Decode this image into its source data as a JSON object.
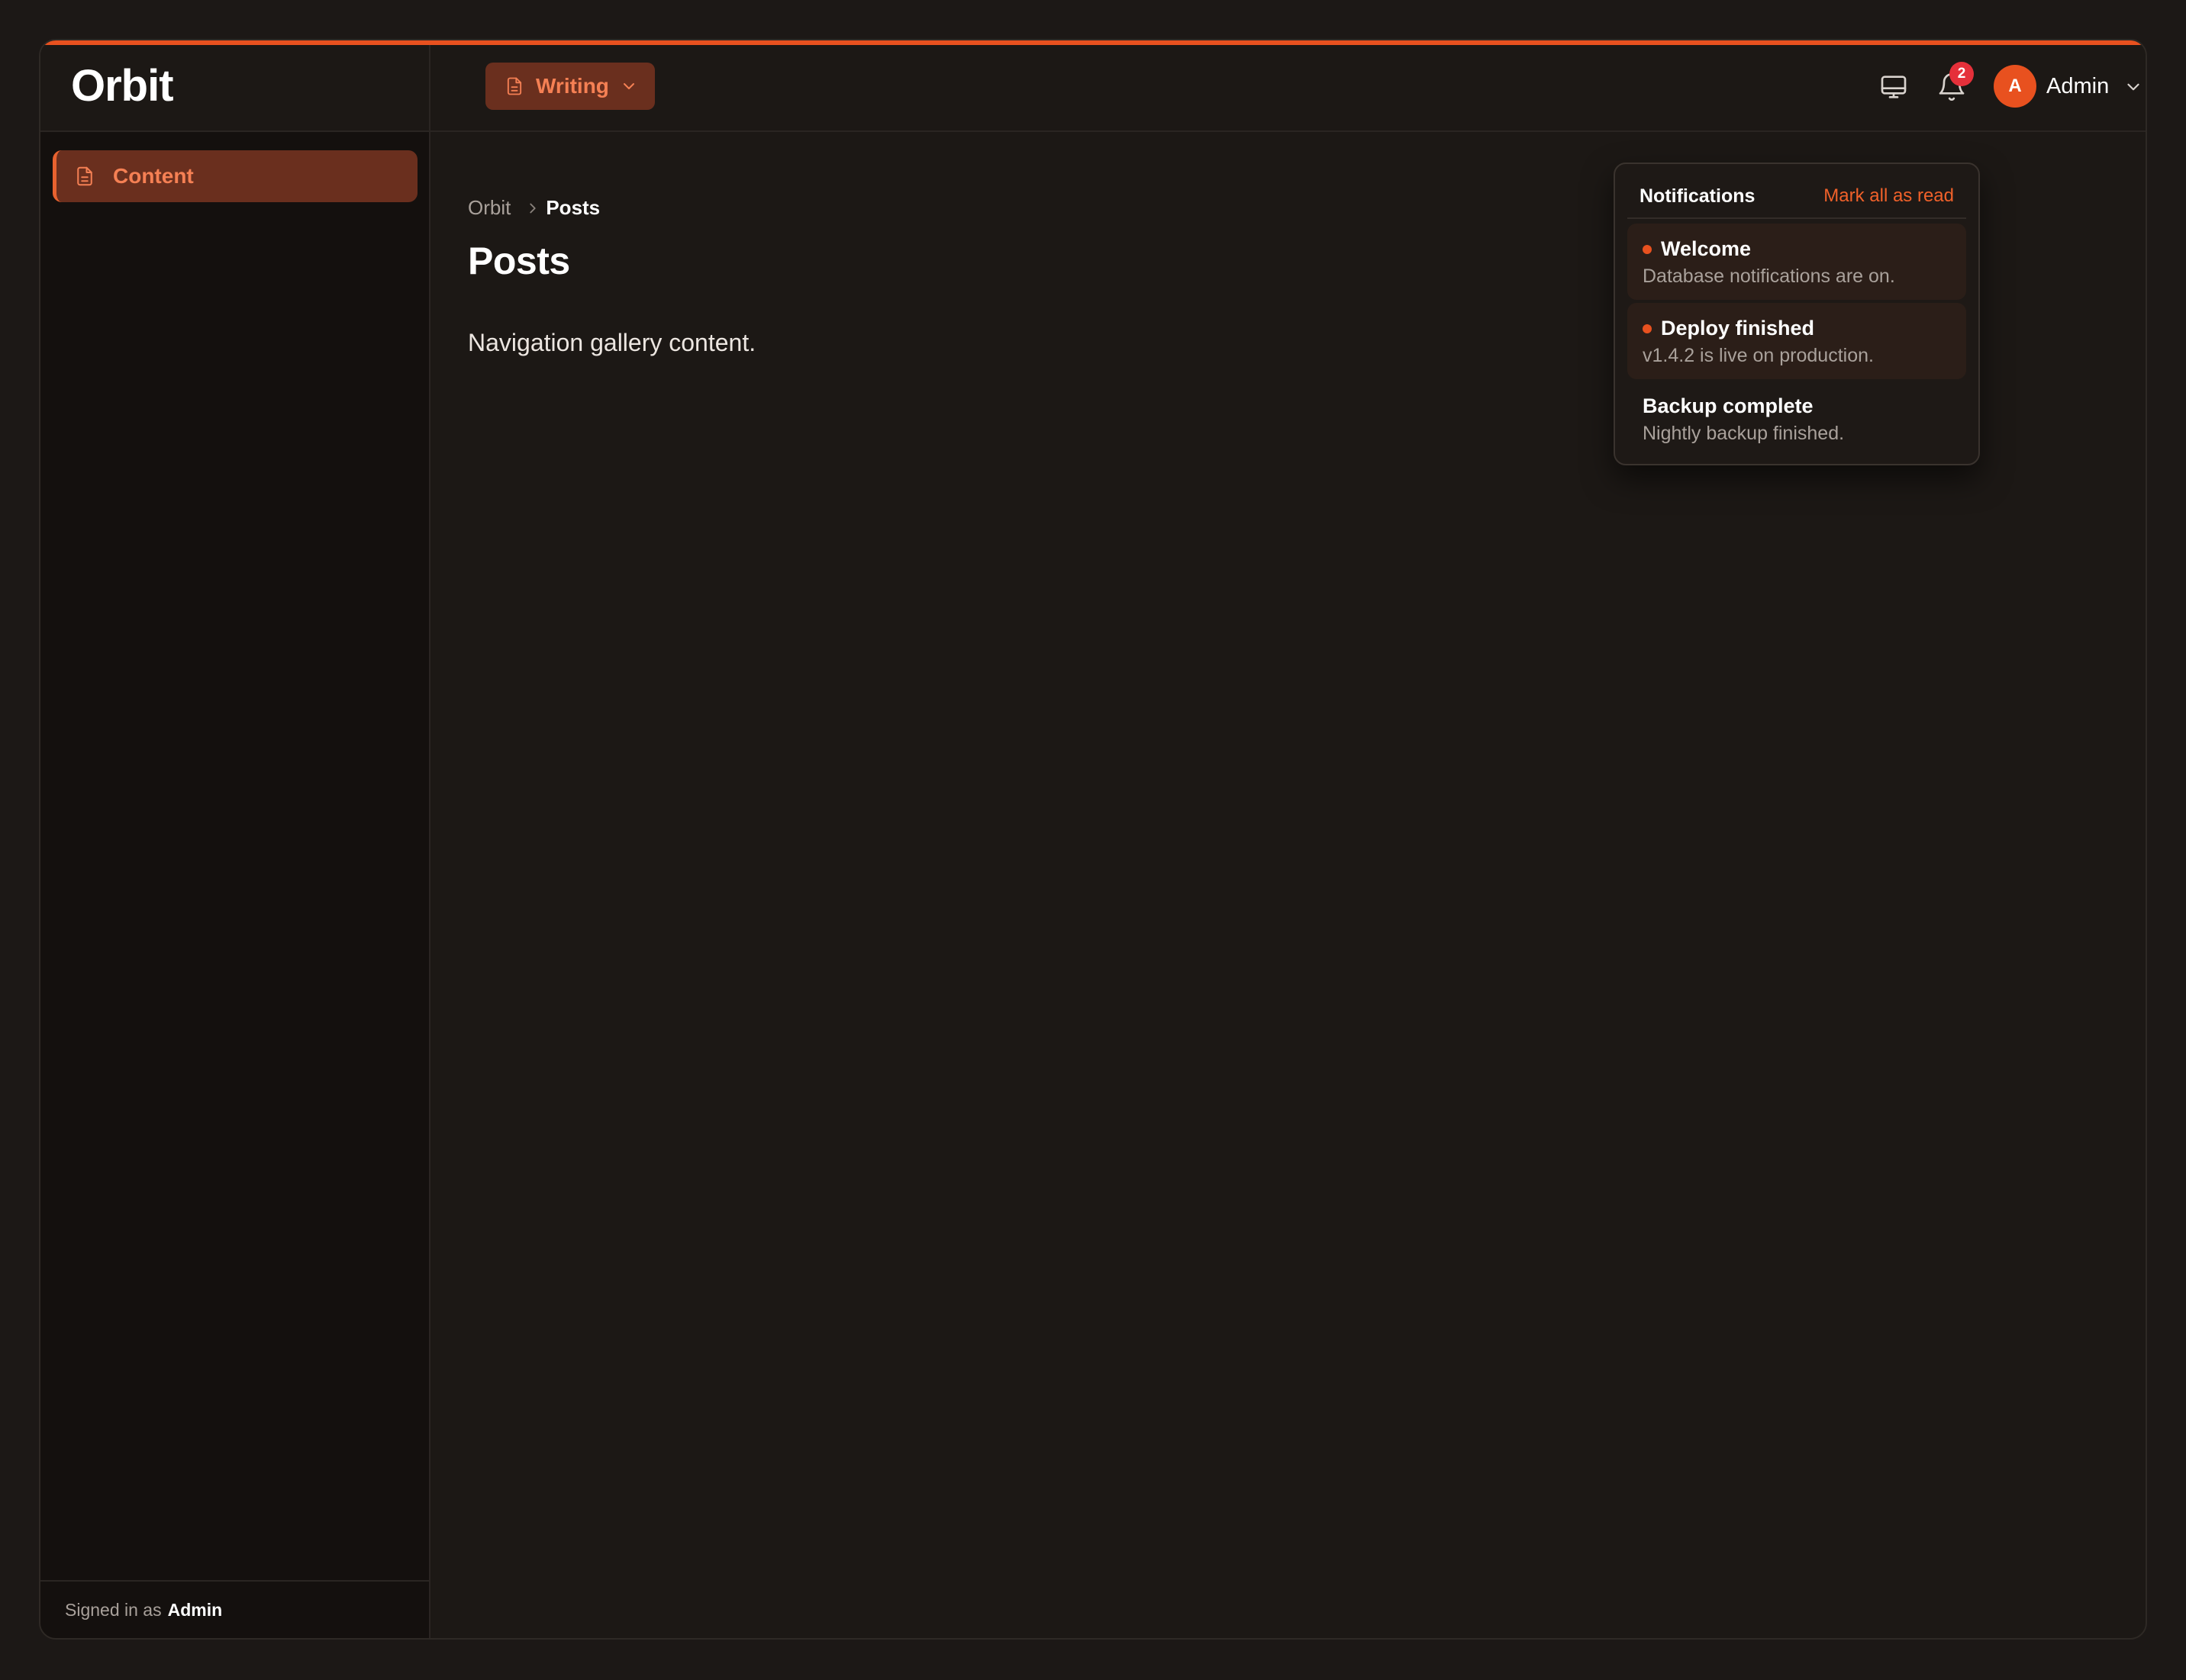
{
  "brand": "Orbit",
  "sidebar": {
    "items": [
      {
        "label": "Content",
        "icon": "document-icon"
      }
    ],
    "footer_prefix": "Signed in as",
    "footer_user": "Admin"
  },
  "topbar": {
    "context_label": "Writing",
    "notification_count": "2",
    "avatar_initial": "A",
    "user_name": "Admin"
  },
  "breadcrumb": {
    "root": "Orbit",
    "current": "Posts"
  },
  "page": {
    "title": "Posts",
    "body": "Navigation gallery content."
  },
  "notifications": {
    "title": "Notifications",
    "mark_all_label": "Mark all as read",
    "items": [
      {
        "title": "Welcome",
        "body": "Database notifications are on.",
        "unread": true
      },
      {
        "title": "Deploy finished",
        "body": "v1.4.2 is live on production.",
        "unread": true
      },
      {
        "title": "Backup complete",
        "body": "Nightly backup finished.",
        "unread": false
      }
    ]
  },
  "colors": {
    "accent": "#e8511f",
    "accent_text": "#f58054",
    "active_bg": "#6a2f1e",
    "background": "#1c1815",
    "sidebar_bg": "#14100e",
    "badge": "#e5303a"
  }
}
